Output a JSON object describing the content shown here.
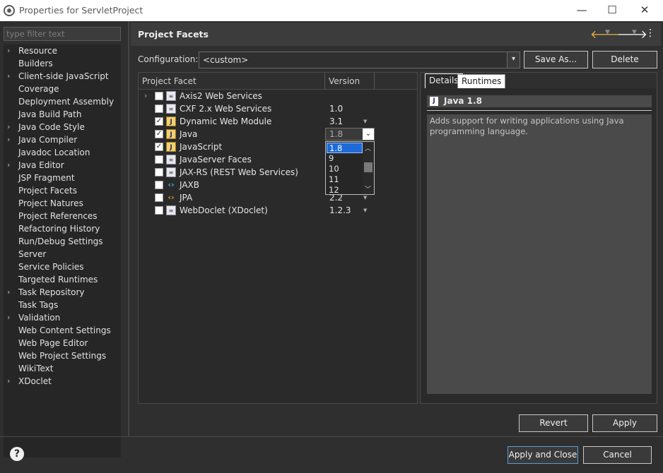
{
  "window": {
    "title": "Properties for ServletProject",
    "minimize": "—",
    "maximize": "☐",
    "close": "✕"
  },
  "filter": {
    "placeholder": "type filter text"
  },
  "tree": [
    {
      "label": "Resource",
      "expandable": true
    },
    {
      "label": "Builders",
      "expandable": false
    },
    {
      "label": "Client-side JavaScript",
      "expandable": true
    },
    {
      "label": "Coverage",
      "expandable": false
    },
    {
      "label": "Deployment Assembly",
      "expandable": false
    },
    {
      "label": "Java Build Path",
      "expandable": false
    },
    {
      "label": "Java Code Style",
      "expandable": true
    },
    {
      "label": "Java Compiler",
      "expandable": true
    },
    {
      "label": "Javadoc Location",
      "expandable": false
    },
    {
      "label": "Java Editor",
      "expandable": true
    },
    {
      "label": "JSP Fragment",
      "expandable": false
    },
    {
      "label": "Project Facets",
      "expandable": false
    },
    {
      "label": "Project Natures",
      "expandable": false
    },
    {
      "label": "Project References",
      "expandable": false
    },
    {
      "label": "Refactoring History",
      "expandable": false
    },
    {
      "label": "Run/Debug Settings",
      "expandable": false
    },
    {
      "label": "Server",
      "expandable": false
    },
    {
      "label": "Service Policies",
      "expandable": false
    },
    {
      "label": "Targeted Runtimes",
      "expandable": false
    },
    {
      "label": "Task Repository",
      "expandable": true
    },
    {
      "label": "Task Tags",
      "expandable": false
    },
    {
      "label": "Validation",
      "expandable": true
    },
    {
      "label": "Web Content Settings",
      "expandable": false
    },
    {
      "label": "Web Page Editor",
      "expandable": false
    },
    {
      "label": "Web Project Settings",
      "expandable": false
    },
    {
      "label": "WikiText",
      "expandable": false
    },
    {
      "label": "XDoclet",
      "expandable": true
    }
  ],
  "header": {
    "title": "Project Facets"
  },
  "configuration": {
    "label": "Configuration:",
    "value": "<custom>",
    "save_as": "Save As...",
    "delete": "Delete"
  },
  "facets": {
    "col_facet": "Project Facet",
    "col_version": "Version",
    "rows": [
      {
        "name": "Axis2 Web Services",
        "version": "",
        "checked": false,
        "expander": true,
        "icon": "doc",
        "dropdown": false
      },
      {
        "name": "CXF 2.x Web Services",
        "version": "1.0",
        "checked": false,
        "expander": false,
        "icon": "doc",
        "dropdown": false
      },
      {
        "name": "Dynamic Web Module",
        "version": "3.1",
        "checked": true,
        "expander": false,
        "icon": "java",
        "dropdown": true
      },
      {
        "name": "Java",
        "version": "1.8",
        "checked": true,
        "expander": false,
        "icon": "java",
        "dropdown": true
      },
      {
        "name": "JavaScript",
        "version": "",
        "checked": true,
        "expander": false,
        "icon": "java",
        "dropdown": false
      },
      {
        "name": "JavaServer Faces",
        "version": "",
        "checked": false,
        "expander": false,
        "icon": "doc",
        "dropdown": false
      },
      {
        "name": "JAX-RS (REST Web Services)",
        "version": "",
        "checked": false,
        "expander": false,
        "icon": "doc",
        "dropdown": false
      },
      {
        "name": "JAXB",
        "version": "",
        "checked": false,
        "expander": false,
        "icon": "jaxb",
        "dropdown": false
      },
      {
        "name": "JPA",
        "version": "2.2",
        "checked": false,
        "expander": false,
        "icon": "jpa",
        "dropdown": true
      },
      {
        "name": "WebDoclet (XDoclet)",
        "version": "1.2.3",
        "checked": false,
        "expander": false,
        "icon": "doc",
        "dropdown": true
      }
    ],
    "java_version_options": [
      "1.8",
      "9",
      "10",
      "11",
      "12"
    ],
    "java_version_selected": "1.8"
  },
  "details": {
    "tab_details": "Details",
    "tab_runtimes": "Runtimes",
    "facet_title": "Java 1.8",
    "description": "Adds support for writing applications using Java programming language."
  },
  "buttons": {
    "revert": "Revert",
    "apply": "Apply",
    "apply_and_close": "Apply and Close",
    "cancel": "Cancel"
  }
}
